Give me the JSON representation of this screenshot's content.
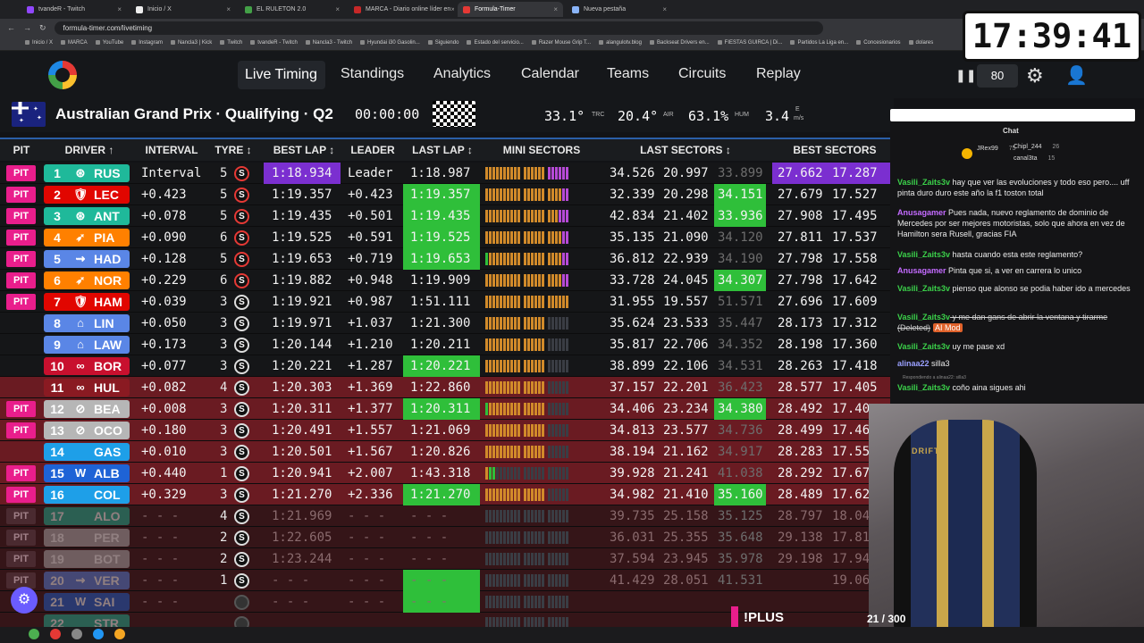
{
  "browser": {
    "tabs": [
      {
        "label": "tvandeR - Twitch",
        "color": "#9147ff"
      },
      {
        "label": "Inicio / X",
        "color": "#eeeeee"
      },
      {
        "label": "EL RULETON 2.0",
        "color": "#43a047"
      },
      {
        "label": "MARCA - Diario online líder en",
        "color": "#c62828"
      },
      {
        "label": "Formula-Timer",
        "color": "#e53935"
      },
      {
        "label": "Nueva pestaña",
        "color": "#8ab4f8"
      }
    ],
    "active_tab": 4,
    "url": "formula-timer.com/livetiming",
    "bookmarks": [
      "Inicio / X",
      "MARCA",
      "YouTube",
      "Instagram",
      "Nancla3 | Kick",
      "Twitch",
      "tvandeR - Twitch",
      "Nancla3 - Twitch",
      "Hyundai i30 Gasolin...",
      "Siguiendo",
      "Estado del servicio...",
      "Razer Mouse Grip T...",
      "alangulotv.blog",
      "Backseat Drivers en...",
      "FIESTAS GUIRCA | Di...",
      "Partidos La Liga en...",
      "Concesionarios",
      "dolares"
    ]
  },
  "clock": "17:39:41",
  "nav": {
    "items": [
      "Live Timing",
      "Standings",
      "Analytics",
      "Calendar",
      "Teams",
      "Circuits",
      "Replay"
    ],
    "delay": "80"
  },
  "session": {
    "title": "Australian Grand Prix · Qualifying · Q2",
    "timer": "00:00:00",
    "track_temp": "33.1°",
    "track_label": "TRC",
    "air_temp": "20.4°",
    "air_label": "AIR",
    "humidity": "63.1%",
    "hum_label": "HUM",
    "wind": "3.4",
    "wind_unit": "m/s",
    "wind_dir": "E"
  },
  "columns": [
    "PIT",
    "DRIVER ↑",
    "INTERVAL",
    "TYRE ↕",
    "BEST LAP ↕",
    "LEADER",
    "LAST LAP ↕",
    "MINI SECTORS",
    "LAST SECTORS ↕",
    "BEST SECTORS"
  ],
  "drivers": [
    {
      "pit": "PIT",
      "pos": "1",
      "code": "RUS",
      "color": "#1fb99a",
      "icon": "⊛",
      "interval": "Interval",
      "tyre_laps": "5",
      "tyre": "S",
      "tyre_soft": true,
      "best": "1:18.934",
      "best_hl": "purple",
      "leader": "Leader",
      "last": "1:18.987",
      "last_hl": "",
      "mini": "oooooooooo-oooooo-pppppp",
      "s1": "34.526",
      "s2": "20.997",
      "s3": "33.899",
      "s3_hl": "dim",
      "b1": "27.662",
      "b2": "17.287",
      "b_hl": "purple",
      "row": ""
    },
    {
      "pit": "PIT",
      "pos": "2",
      "code": "LEC",
      "color": "#e10600",
      "icon": "🛡",
      "interval": "+0.423",
      "tyre_laps": "5",
      "tyre": "S",
      "tyre_soft": true,
      "best": "1:19.357",
      "best_hl": "",
      "leader": "+0.423",
      "last": "1:19.357",
      "last_hl": "green",
      "mini": "oooooooooo-oooooo-oooopp",
      "s1": "32.339",
      "s2": "20.298",
      "s3": "34.151",
      "s3_hl": "green",
      "b1": "27.679",
      "b2": "17.527",
      "b_hl": "",
      "row": ""
    },
    {
      "pit": "PIT",
      "pos": "3",
      "code": "ANT",
      "color": "#1fb99a",
      "icon": "⊛",
      "interval": "+0.078",
      "tyre_laps": "5",
      "tyre": "S",
      "tyre_soft": true,
      "best": "1:19.435",
      "best_hl": "",
      "leader": "+0.501",
      "last": "1:19.435",
      "last_hl": "green",
      "mini": "oooooooooo-oooooo-oooppp",
      "s1": "42.834",
      "s2": "21.402",
      "s3": "33.936",
      "s3_hl": "green",
      "b1": "27.908",
      "b2": "17.495",
      "b_hl": "",
      "row": ""
    },
    {
      "pit": "PIT",
      "pos": "4",
      "code": "PIA",
      "color": "#ff8000",
      "icon": "➶",
      "interval": "+0.090",
      "tyre_laps": "6",
      "tyre": "S",
      "tyre_soft": true,
      "best": "1:19.525",
      "best_hl": "",
      "leader": "+0.591",
      "last": "1:19.525",
      "last_hl": "green",
      "mini": "oooooooooo-oooooo-oooopp",
      "s1": "35.135",
      "s2": "21.090",
      "s3": "34.120",
      "s3_hl": "dim",
      "b1": "27.811",
      "b2": "17.537",
      "b_hl": "",
      "row": ""
    },
    {
      "pit": "PIT",
      "pos": "5",
      "code": "HAD",
      "color": "#5a86e6",
      "icon": "⇝",
      "interval": "+0.128",
      "tyre_laps": "5",
      "tyre": "S",
      "tyre_soft": true,
      "best": "1:19.653",
      "best_hl": "",
      "leader": "+0.719",
      "last": "1:19.653",
      "last_hl": "green",
      "mini": "gooooooooo-oooooo-oooopp",
      "s1": "36.812",
      "s2": "22.939",
      "s3": "34.190",
      "s3_hl": "dim",
      "b1": "27.798",
      "b2": "17.558",
      "b_hl": "",
      "row": ""
    },
    {
      "pit": "PIT",
      "pos": "6",
      "code": "NOR",
      "color": "#ff8000",
      "icon": "➶",
      "interval": "+0.229",
      "tyre_laps": "6",
      "tyre": "S",
      "tyre_soft": true,
      "best": "1:19.882",
      "best_hl": "",
      "leader": "+0.948",
      "last": "1:19.909",
      "last_hl": "",
      "mini": "oooooooooo-oooooo-oooopp",
      "s1": "33.728",
      "s2": "24.045",
      "s3": "34.307",
      "s3_hl": "green",
      "b1": "27.798",
      "b2": "17.642",
      "b_hl": "",
      "row": ""
    },
    {
      "pit": "PIT",
      "pos": "7",
      "code": "HAM",
      "color": "#e10600",
      "icon": "🛡",
      "interval": "+0.039",
      "tyre_laps": "3",
      "tyre": "S",
      "tyre_soft": false,
      "best": "1:19.921",
      "best_hl": "",
      "leader": "+0.987",
      "last": "1:51.111",
      "last_hl": "",
      "mini": "oooooooooo-oooooo-oooooo",
      "s1": "31.955",
      "s2": "19.557",
      "s3": "51.571",
      "s3_hl": "dim",
      "b1": "27.696",
      "b2": "17.609",
      "b_hl": "",
      "row": ""
    },
    {
      "pit": "",
      "pos": "8",
      "code": "LIN",
      "color": "#5a86e6",
      "icon": "⌂",
      "interval": "+0.050",
      "tyre_laps": "3",
      "tyre": "S",
      "tyre_soft": false,
      "best": "1:19.971",
      "best_hl": "",
      "leader": "+1.037",
      "last": "1:21.300",
      "last_hl": "",
      "mini": "oooooooooo-oooooo-kkkkkk",
      "s1": "35.624",
      "s2": "23.533",
      "s3": "35.447",
      "s3_hl": "dim",
      "b1": "28.173",
      "b2": "17.312",
      "b_hl": "",
      "row": ""
    },
    {
      "pit": "",
      "pos": "9",
      "code": "LAW",
      "color": "#5a86e6",
      "icon": "⌂",
      "interval": "+0.173",
      "tyre_laps": "3",
      "tyre": "S",
      "tyre_soft": false,
      "best": "1:20.144",
      "best_hl": "",
      "leader": "+1.210",
      "last": "1:20.211",
      "last_hl": "",
      "mini": "oooooooooo-oooooo-kkkkkk",
      "s1": "35.817",
      "s2": "22.706",
      "s3": "34.352",
      "s3_hl": "dim",
      "b1": "28.198",
      "b2": "17.360",
      "b_hl": "",
      "row": ""
    },
    {
      "pit": "",
      "pos": "10",
      "code": "BOR",
      "color": "#c8102e",
      "icon": "∞",
      "interval": "+0.077",
      "tyre_laps": "3",
      "tyre": "S",
      "tyre_soft": false,
      "best": "1:20.221",
      "best_hl": "",
      "leader": "+1.287",
      "last": "1:20.221",
      "last_hl": "green",
      "mini": "oooooooooo-oooooo-kkkkkk",
      "s1": "38.899",
      "s2": "22.106",
      "s3": "34.531",
      "s3_hl": "dim",
      "b1": "28.263",
      "b2": "17.418",
      "b_hl": "",
      "row": ""
    },
    {
      "pit": "",
      "pos": "11",
      "code": "HUL",
      "color": "#8a1a22",
      "icon": "∞",
      "interval": "+0.082",
      "tyre_laps": "4",
      "tyre": "S",
      "tyre_soft": false,
      "best": "1:20.303",
      "best_hl": "",
      "leader": "+1.369",
      "last": "1:22.860",
      "last_hl": "",
      "mini": "oooooooooo-oooooo-kkkkkk",
      "s1": "37.157",
      "s2": "22.201",
      "s3": "36.423",
      "s3_hl": "dim",
      "b1": "28.577",
      "b2": "17.405",
      "b_hl": "",
      "row": "red"
    },
    {
      "pit": "PIT",
      "pos": "12",
      "code": "BEA",
      "color": "#b6b6b6",
      "icon": "⊘",
      "interval": "+0.008",
      "tyre_laps": "3",
      "tyre": "S",
      "tyre_soft": false,
      "best": "1:20.311",
      "best_hl": "",
      "leader": "+1.377",
      "last": "1:20.311",
      "last_hl": "green",
      "mini": "gooooooooo-oooooo-kkkkkk",
      "s1": "34.406",
      "s2": "23.234",
      "s3": "34.380",
      "s3_hl": "green",
      "b1": "28.492",
      "b2": "17.40",
      "b_hl": "",
      "row": "red"
    },
    {
      "pit": "PIT",
      "pos": "13",
      "code": "OCO",
      "color": "#b6b6b6",
      "icon": "⊘",
      "interval": "+0.180",
      "tyre_laps": "3",
      "tyre": "S",
      "tyre_soft": false,
      "best": "1:20.491",
      "best_hl": "",
      "leader": "+1.557",
      "last": "1:21.069",
      "last_hl": "",
      "mini": "oooooooooo-oooooo-kkkkkk",
      "s1": "34.813",
      "s2": "23.577",
      "s3": "34.736",
      "s3_hl": "dim",
      "b1": "28.499",
      "b2": "17.46",
      "b_hl": "",
      "row": "red"
    },
    {
      "pit": "",
      "pos": "14",
      "code": "GAS",
      "color": "#1e9fe8",
      "icon": "",
      "interval": "+0.010",
      "tyre_laps": "3",
      "tyre": "S",
      "tyre_soft": false,
      "best": "1:20.501",
      "best_hl": "",
      "leader": "+1.567",
      "last": "1:20.826",
      "last_hl": "",
      "mini": "oooooooooo-oooooo-kkkkkk",
      "s1": "38.194",
      "s2": "21.162",
      "s3": "34.917",
      "s3_hl": "dim",
      "b1": "28.283",
      "b2": "17.55",
      "b_hl": "",
      "row": "red"
    },
    {
      "pit": "PIT",
      "pos": "15",
      "code": "ALB",
      "color": "#1e63d6",
      "icon": "W",
      "interval": "+0.440",
      "tyre_laps": "1",
      "tyre": "S",
      "tyre_soft": false,
      "best": "1:20.941",
      "best_hl": "",
      "leader": "+2.007",
      "last": "1:43.318",
      "last_hl": "",
      "mini": "oggkkkkkkk-kkkkkk-kkkkkk",
      "s1": "39.928",
      "s2": "21.241",
      "s3": "41.038",
      "s3_hl": "dim",
      "b1": "28.292",
      "b2": "17.67",
      "b_hl": "",
      "row": "red"
    },
    {
      "pit": "PIT",
      "pos": "16",
      "code": "COL",
      "color": "#1e9fe8",
      "icon": "",
      "interval": "+0.329",
      "tyre_laps": "3",
      "tyre": "S",
      "tyre_soft": false,
      "best": "1:21.270",
      "best_hl": "",
      "leader": "+2.336",
      "last": "1:21.270",
      "last_hl": "green",
      "mini": "oooooooooo-oooooo-kkkkkk",
      "s1": "34.982",
      "s2": "21.410",
      "s3": "35.160",
      "s3_hl": "green",
      "b1": "28.489",
      "b2": "17.62",
      "b_hl": "",
      "row": "red"
    },
    {
      "pit": "PIT",
      "pos": "17",
      "code": "ALO",
      "color": "#1fb99a",
      "icon": "",
      "interval": "- - -",
      "tyre_laps": "4",
      "tyre": "S",
      "tyre_soft": false,
      "best": "1:21.969",
      "best_hl": "",
      "leader": "- - -",
      "last": "- - -",
      "last_hl": "",
      "mini": "kkkkkkkkkk-kkkkkk-kkkkkk",
      "s1": "39.735",
      "s2": "25.158",
      "s3": "35.125",
      "s3_hl": "dim",
      "b1": "28.797",
      "b2": "18.04",
      "b_hl": "",
      "row": "gone"
    },
    {
      "pit": "PIT",
      "pos": "18",
      "code": "PER",
      "color": "#b6b6b6",
      "icon": "",
      "interval": "- - -",
      "tyre_laps": "2",
      "tyre": "S",
      "tyre_soft": false,
      "best": "1:22.605",
      "best_hl": "",
      "leader": "- - -",
      "last": "- - -",
      "last_hl": "",
      "mini": "kkkkkkkkkk-kkkkkk-kkkkkk",
      "s1": "36.031",
      "s2": "25.355",
      "s3": "35.648",
      "s3_hl": "dim",
      "b1": "29.138",
      "b2": "17.81",
      "b_hl": "",
      "row": "gone"
    },
    {
      "pit": "PIT",
      "pos": "19",
      "code": "BOT",
      "color": "#b6b6b6",
      "icon": "",
      "interval": "- - -",
      "tyre_laps": "2",
      "tyre": "S",
      "tyre_soft": false,
      "best": "1:23.244",
      "best_hl": "",
      "leader": "- - -",
      "last": "- - -",
      "last_hl": "",
      "mini": "kkkkkkkkkk-kkkkkk-kkkkkk",
      "s1": "37.594",
      "s2": "23.945",
      "s3": "35.978",
      "s3_hl": "dim",
      "b1": "29.198",
      "b2": "17.94",
      "b_hl": "",
      "row": "gone"
    },
    {
      "pit": "PIT",
      "pos": "20",
      "code": "VER",
      "color": "#5a86e6",
      "icon": "⇝",
      "interval": "- - -",
      "tyre_laps": "1",
      "tyre": "S",
      "tyre_soft": false,
      "best": "- - -",
      "best_hl": "",
      "leader": "- - -",
      "last": "- - -",
      "last_hl": "green",
      "mini": "kkkkkkkkkk-kkkkkk-kkkkkk",
      "s1": "41.429",
      "s2": "28.051",
      "s3": "41.531",
      "s3_hl": "dim",
      "b1": "",
      "b2": "19.06",
      "b_hl": "",
      "row": "gone"
    },
    {
      "pit": "",
      "pos": "21",
      "code": "SAI",
      "color": "#1e63d6",
      "icon": "W",
      "interval": "- - -",
      "tyre_laps": "",
      "tyre": "",
      "tyre_soft": false,
      "best": "- - -",
      "best_hl": "",
      "leader": "- - -",
      "last": "- - -",
      "last_hl": "green",
      "mini": "kkkkkkkkkk-kkkkkk-kkkkkk",
      "s1": "",
      "s2": "",
      "s3": "",
      "s3_hl": "",
      "b1": "",
      "b2": "",
      "b_hl": "",
      "row": "gone"
    },
    {
      "pit": "",
      "pos": "22",
      "code": "STR",
      "color": "#1fb99a",
      "icon": "",
      "interval": "",
      "tyre_laps": "",
      "tyre": "",
      "tyre_soft": false,
      "best": "",
      "best_hl": "",
      "leader": "",
      "last": "",
      "last_hl": "",
      "mini": "kkkkkkkkkk-kkkkkk-kkkkkk",
      "s1": "",
      "s2": "",
      "s3": "",
      "s3_hl": "",
      "b1": "",
      "b2": "",
      "b_hl": "",
      "row": "gone"
    }
  ],
  "chat": {
    "title": "Chat",
    "top": [
      {
        "user": "JRex99",
        "value": "75"
      },
      {
        "user": "Chipl_244",
        "value": "26"
      },
      {
        "user": "canal3ta",
        "value": "15"
      }
    ],
    "messages": [
      {
        "user": "Vasili_Zaits3v",
        "cls": "",
        "text": " hay que ver las evoluciones y todo eso pero.... uff pinta duro duro este año la f1 toston total"
      },
      {
        "user": "Anusagamer",
        "cls": "y",
        "text": " Pues nada, nuevo reglamento de dominio de Mercedes por ser mejores motoristas, solo que ahora en vez de Hamilton sera Rusell, gracias FIA"
      },
      {
        "user": "Vasili_Zaits3v",
        "cls": "",
        "text": " hasta cuando esta este reglamento?"
      },
      {
        "user": "Anusagamer",
        "cls": "y",
        "text": " Pinta que si, a ver en carrera lo unico"
      },
      {
        "user": "Vasili_Zaits3v",
        "cls": "",
        "text": " pienso que alonso se podia haber ido a mercedes"
      },
      {
        "user": "Vasili_Zaits3v",
        "cls": "",
        "text": " y me dan gans de abrir la ventana y tirarme (Deleted)",
        "deleted": true,
        "badge": "AI Mod"
      },
      {
        "user": "Vasili_Zaits3v",
        "cls": "",
        "text": " uy me pase xd"
      },
      {
        "user": "alinaa22",
        "cls": "p",
        "text": " silla3"
      },
      {
        "user": "Vasili_Zaits3v",
        "cls": "",
        "text": " coño aina sigues ahi"
      }
    ],
    "reply_note": "Respondiendo a alinaa22: silla3"
  },
  "camera": {
    "chair_brand": "DRIFT"
  },
  "overlay": {
    "plus": "!PLUS",
    "count": "21 / 300"
  }
}
